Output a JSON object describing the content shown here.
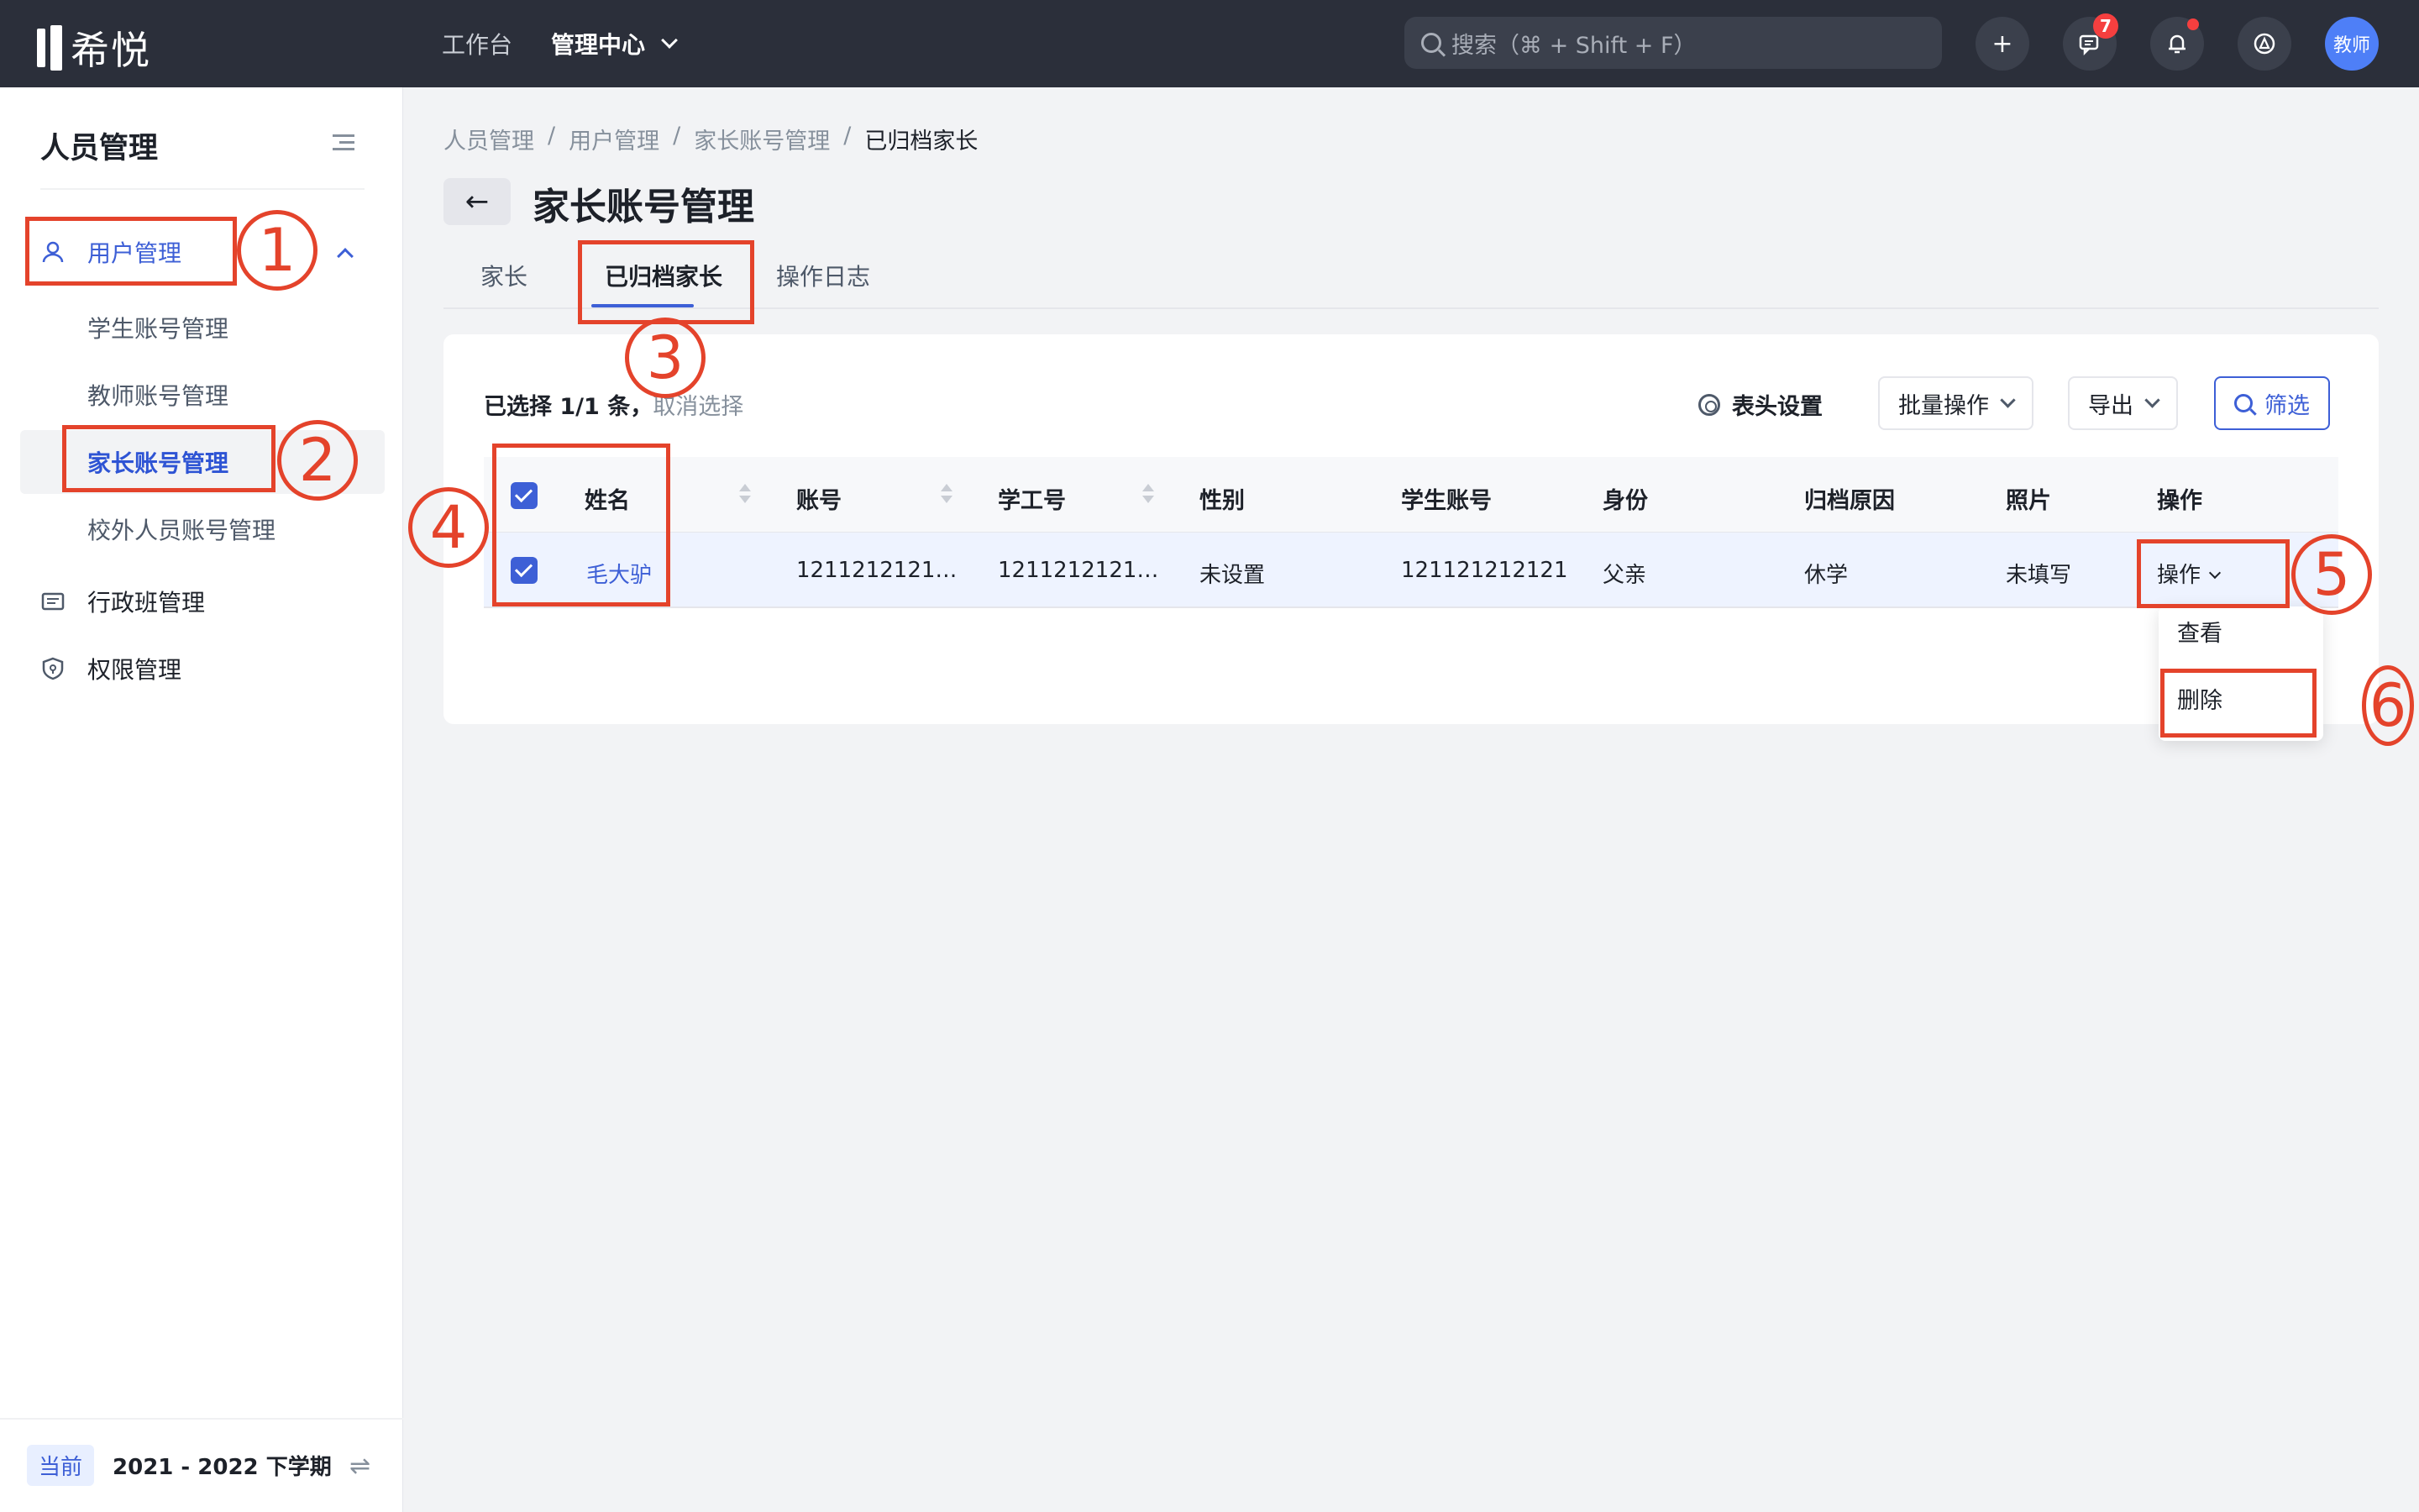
{
  "topbar": {
    "logo_text": "希悦",
    "nav": [
      "工作台",
      "管理中心"
    ],
    "search_placeholder": "搜索（⌘ + Shift + F）",
    "add_label": "+",
    "message_badge": "7",
    "avatar_label": "教师"
  },
  "sidebar": {
    "title": "人员管理",
    "group_user": "用户管理",
    "sub_items": [
      "学生账号管理",
      "教师账号管理",
      "家长账号管理",
      "校外人员账号管理"
    ],
    "item_class": "行政班管理",
    "item_permission": "权限管理",
    "term_tag": "当前",
    "term_text": "2021 - 2022 下学期",
    "switch_glyph": "⇌"
  },
  "breadcrumb": [
    "人员管理",
    "用户管理",
    "家长账号管理",
    "已归档家长"
  ],
  "breadcrumb_sep": "/",
  "page": {
    "back_glyph": "←",
    "title": "家长账号管理"
  },
  "tabs": [
    "家长",
    "已归档家长",
    "操作日志"
  ],
  "toolbar": {
    "selected_text": "已选择 1/1 条，",
    "cancel_select": "取消选择",
    "header_settings": "表头设置",
    "batch_ops": "批量操作",
    "export": "导出",
    "filter": "筛选"
  },
  "table": {
    "columns": [
      "姓名",
      "账号",
      "学工号",
      "性别",
      "学生账号",
      "身份",
      "归档原因",
      "照片",
      "操作"
    ],
    "row": {
      "name": "毛大驴",
      "account": "1211212121…",
      "staff_id": "1211212121…",
      "gender": "未设置",
      "student_account": "121121212121",
      "identity": "父亲",
      "reason": "休学",
      "photo": "未填写",
      "action": "操作"
    }
  },
  "dropdown": [
    "查看",
    "删除"
  ],
  "annotations": [
    "1",
    "2",
    "3",
    "4",
    "5",
    "6"
  ],
  "colors": {
    "accent": "#3d5fd6",
    "annotation": "#e4432b",
    "topbar": "#2b2f3a"
  }
}
